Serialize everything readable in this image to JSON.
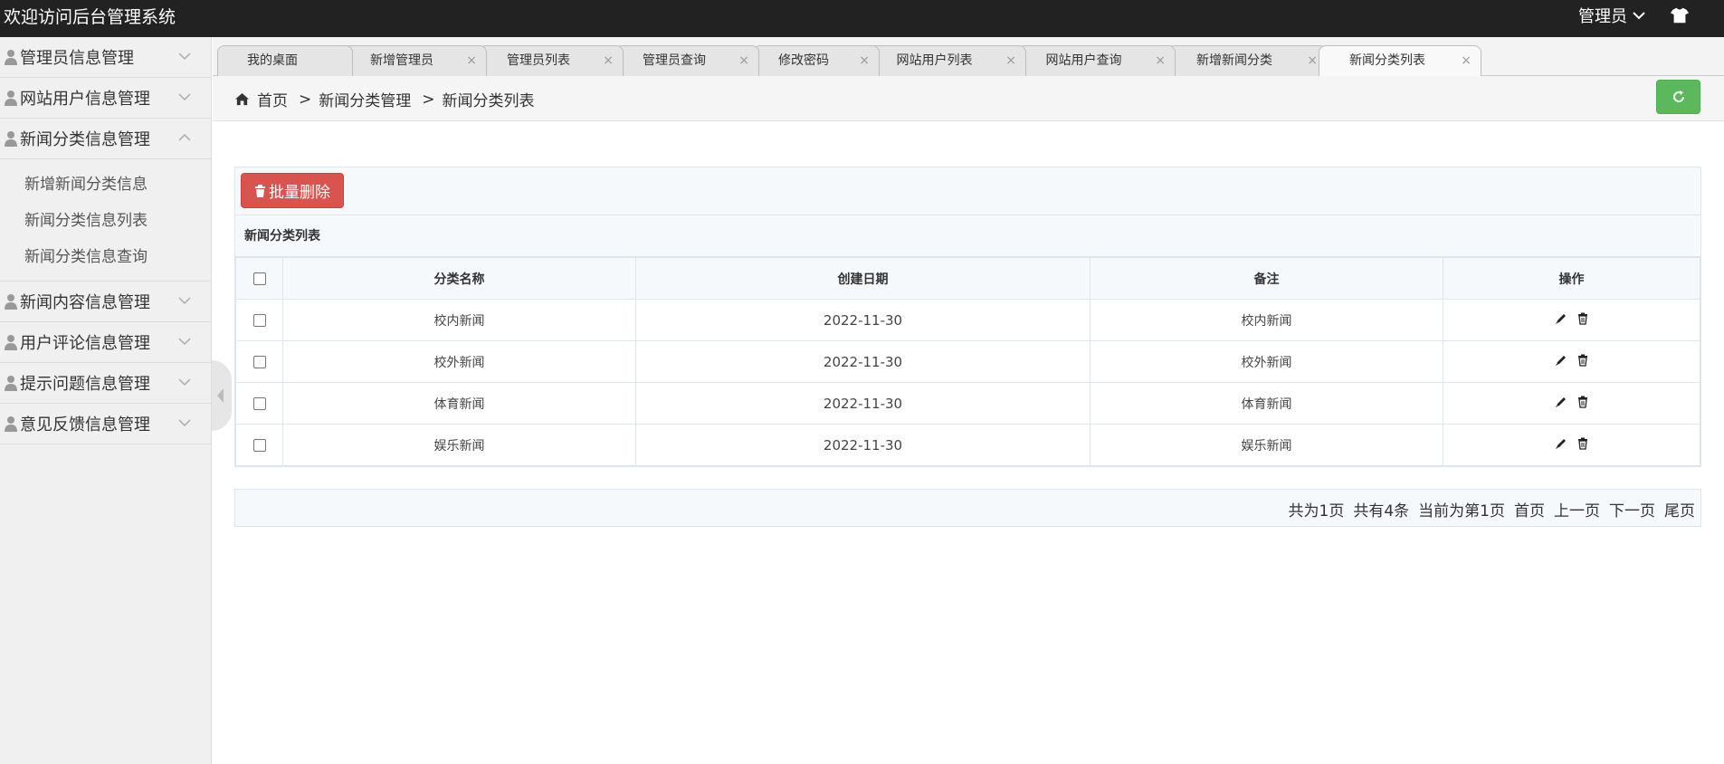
{
  "header": {
    "title": "欢迎访问后台管理系统",
    "user_label": "管理员"
  },
  "sidebar": {
    "groups": [
      {
        "label": "管理员信息管理",
        "expanded": false
      },
      {
        "label": "网站用户信息管理",
        "expanded": false
      },
      {
        "label": "新闻分类信息管理",
        "expanded": true,
        "items": [
          "新增新闻分类信息",
          "新闻分类信息列表",
          "新闻分类信息查询"
        ]
      },
      {
        "label": "新闻内容信息管理",
        "expanded": false
      },
      {
        "label": "用户评论信息管理",
        "expanded": false
      },
      {
        "label": "提示问题信息管理",
        "expanded": false
      },
      {
        "label": "意见反馈信息管理",
        "expanded": false
      }
    ]
  },
  "tabs": [
    {
      "label": "我的桌面",
      "closable": false
    },
    {
      "label": "新增管理员",
      "closable": true
    },
    {
      "label": "管理员列表",
      "closable": true
    },
    {
      "label": "管理员查询",
      "closable": true
    },
    {
      "label": "修改密码",
      "closable": true
    },
    {
      "label": "网站用户列表",
      "closable": true
    },
    {
      "label": "网站用户查询",
      "closable": true
    },
    {
      "label": "新增新闻分类",
      "closable": true
    },
    {
      "label": "新闻分类列表",
      "closable": true,
      "active": true
    }
  ],
  "tab_close_glyph": "×",
  "breadcrumb": {
    "home": "首页",
    "separator": ">",
    "level1": "新闻分类管理",
    "level2": "新闻分类列表"
  },
  "toolbar": {
    "batch_delete_label": "批量删除"
  },
  "table": {
    "caption": "新闻分类列表",
    "columns": [
      "分类名称",
      "创建日期",
      "备注",
      "操作"
    ],
    "rows": [
      {
        "name": "校内新闻",
        "date": "2022-11-30",
        "note": "校内新闻"
      },
      {
        "name": "校外新闻",
        "date": "2022-11-30",
        "note": "校外新闻"
      },
      {
        "name": "体育新闻",
        "date": "2022-11-30",
        "note": "体育新闻"
      },
      {
        "name": "娱乐新闻",
        "date": "2022-11-30",
        "note": "娱乐新闻"
      }
    ]
  },
  "pager": {
    "total_pages": "共为1页",
    "total_items": "共有4条",
    "current": "当前为第1页",
    "first": "首页",
    "prev": "上一页",
    "next": "下一页",
    "last": "尾页"
  },
  "colors": {
    "topbar": "#222222",
    "refresh_button": "#5cb85c",
    "delete_button": "#d9534f"
  },
  "icons": [
    "person-icon",
    "chevron-down-icon",
    "chevron-up-icon",
    "home-icon",
    "refresh-icon",
    "trash-icon",
    "edit-icon",
    "shirt-icon",
    "close-icon"
  ]
}
